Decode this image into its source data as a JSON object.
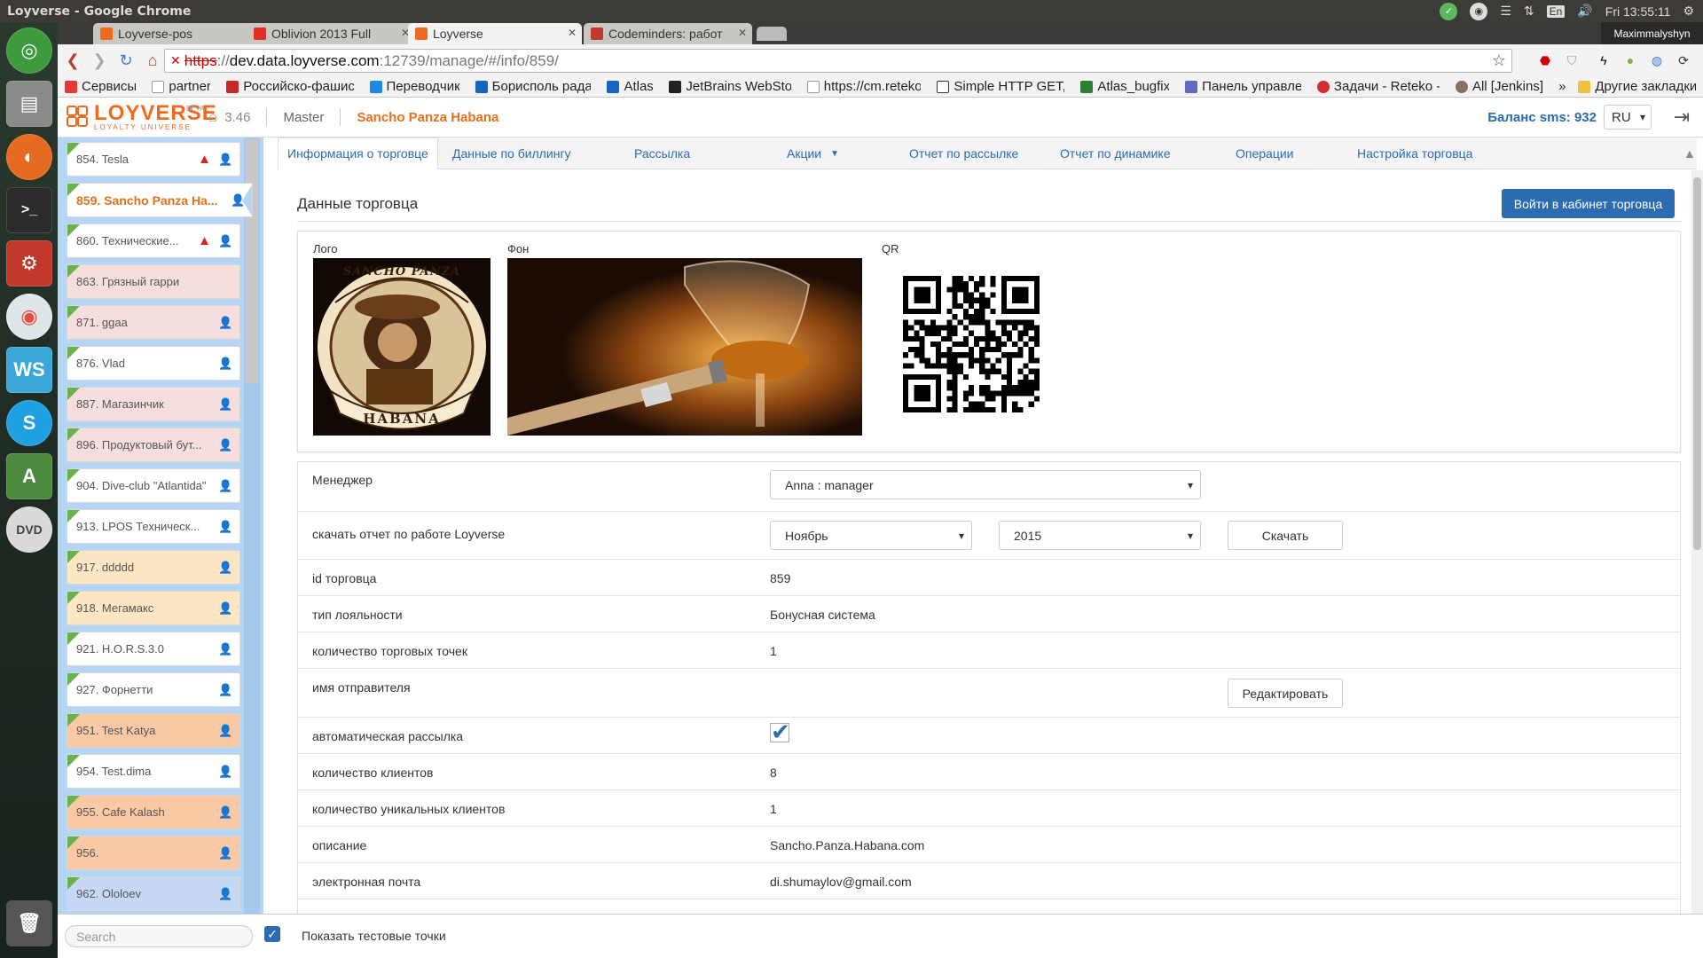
{
  "system": {
    "window_title": "Loyverse - Google Chrome",
    "clock": "Fri 13:55:11",
    "keyboard_layout": "En",
    "user": "Maximmalyshyn"
  },
  "browser": {
    "tabs": [
      {
        "title": "Loyverse-pos",
        "active": false
      },
      {
        "title": "Oblivion 2013 Full",
        "active": false
      },
      {
        "title": "Loyverse",
        "active": true
      },
      {
        "title": "Codeminders: работ",
        "active": false
      }
    ],
    "url": {
      "scheme": "https",
      "rest": "://",
      "host": "dev.data.loyverse.com",
      "path": ":12739/manage/#/info/859/"
    },
    "bookmarks": [
      "Сервисы",
      "partner",
      "Российско-фашис",
      "Переводчик",
      "Борисполь рада",
      "Atlas",
      "JetBrains WebSto",
      "https://cm.reteko",
      "Simple HTTP GET,",
      "Atlas_bugfix",
      "Панель управле",
      "Задачи - Reteko -",
      "All [Jenkins]"
    ],
    "bookmarks_more": "»",
    "other_bookmarks": "Другие закладки"
  },
  "app": {
    "logo_text": "LOYVERSE",
    "logo_tagline": "LOYALTY UNIVERSE",
    "logo_beta": "BETA",
    "version": "3.46",
    "master_label": "Master",
    "merchant_name": "Sancho Panza Habana",
    "sms_balance": "Баланс sms: 932",
    "language": "RU"
  },
  "sidebar": {
    "items": [
      {
        "label": "854. Tesla",
        "warn": true,
        "user": true,
        "color": "#ffffff"
      },
      {
        "label": "859. Sancho Panza Ha...",
        "warn": false,
        "user": true,
        "color": "#ffffff",
        "selected": true
      },
      {
        "label": "860. Технические...",
        "warn": true,
        "user": true,
        "color": "#ffffff"
      },
      {
        "label": "863. Грязный гарри",
        "warn": false,
        "user": false,
        "color": "#f6dede"
      },
      {
        "label": "871. ggaa",
        "warn": false,
        "user": true,
        "color": "#f6dede"
      },
      {
        "label": "876. Vlad",
        "warn": false,
        "user": true,
        "color": "#ffffff"
      },
      {
        "label": "887. Магазинчик",
        "warn": false,
        "user": true,
        "color": "#f6dede"
      },
      {
        "label": "896. Продуктовый бут...",
        "warn": false,
        "user": true,
        "color": "#f6dede"
      },
      {
        "label": "904. Dive-club \"Atlantida\"",
        "warn": false,
        "user": true,
        "color": "#ffffff"
      },
      {
        "label": "913. LPOS Техническ...",
        "warn": false,
        "user": true,
        "color": "#ffffff"
      },
      {
        "label": "917. ddddd",
        "warn": false,
        "user": true,
        "color": "#fde6c4"
      },
      {
        "label": "918. Мегамакс",
        "warn": false,
        "user": true,
        "color": "#fde6c4"
      },
      {
        "label": "921. H.O.R.S.3.0",
        "warn": false,
        "user": true,
        "color": "#ffffff"
      },
      {
        "label": "927. Форнетти",
        "warn": false,
        "user": true,
        "color": "#ffffff"
      },
      {
        "label": "951. Test Katya",
        "warn": false,
        "user": true,
        "color": "#f8c9a4"
      },
      {
        "label": "954. Test.dima",
        "warn": false,
        "user": true,
        "color": "#ffffff"
      },
      {
        "label": "955. Cafe Kalash",
        "warn": false,
        "user": true,
        "color": "#f8c9a4"
      },
      {
        "label": "956.",
        "warn": false,
        "user": true,
        "color": "#f8c9a4"
      },
      {
        "label": "962. Ololoev",
        "warn": false,
        "user": true,
        "color": "#c7d8f5"
      }
    ],
    "search_placeholder": "Search",
    "show_test_label": "Показать тестовые точки"
  },
  "tabs": [
    {
      "label": "Информация о торговце",
      "active": true
    },
    {
      "label": "Данные по биллингу"
    },
    {
      "label": "Рассылка"
    },
    {
      "label": "Акции"
    },
    {
      "label": "Отчет по рассылке"
    },
    {
      "label": "Отчет по динамике"
    },
    {
      "label": "Операции"
    },
    {
      "label": "Настройка торговца"
    }
  ],
  "main": {
    "title": "Данные торговца",
    "enter_button": "Войти в кабинет торговца",
    "image_labels": {
      "logo": "Лого",
      "background": "Фон",
      "qr": "QR"
    },
    "logo_image_text": {
      "top": "SANCHO PANZA",
      "bottom": "HABANA"
    },
    "manager_label": "Менеджер",
    "manager_value": "Anna : manager",
    "report_label": "скачать отчет по работе Loyverse",
    "report_month": "Ноябрь",
    "report_year": "2015",
    "download_button": "Скачать",
    "rows": [
      {
        "key": "id торговца",
        "value": "859"
      },
      {
        "key": "тип лояльности",
        "value": "Бонусная система"
      },
      {
        "key": "количество торговых точек",
        "value": "1"
      }
    ],
    "sender_label": "имя отправителя",
    "edit_button": "Редактировать",
    "auto_mail_label": "автоматическая рассылка",
    "rows2": [
      {
        "key": "количество клиентов",
        "value": "8"
      },
      {
        "key": "количество уникальных клиентов",
        "value": "1"
      },
      {
        "key": "описание",
        "value": "Sancho.Panza.Habana.com"
      },
      {
        "key": "электронная почта",
        "value": "di.shumaylov@gmail.com"
      }
    ]
  }
}
